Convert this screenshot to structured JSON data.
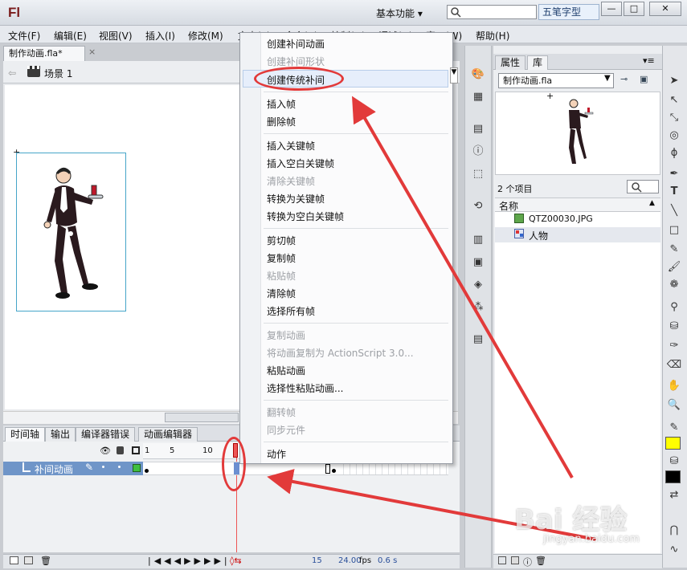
{
  "app": {
    "logo": "Fl",
    "workspace_label": "基本功能 ▾",
    "search_placeholder": "",
    "ime_label": "五笔字型",
    "window_controls": [
      "—",
      "□",
      "✕"
    ]
  },
  "menubar": {
    "items": [
      "文件(F)",
      "编辑(E)",
      "视图(V)",
      "插入(I)",
      "修改(M)",
      "文本(T)",
      "命令(C)",
      "控制(O)",
      "调试(D)",
      "窗口(W)",
      "帮助(H)"
    ]
  },
  "document": {
    "tab_label": "制作动画.fla*",
    "tab_close": "×",
    "scene_label": "场景 1"
  },
  "context_menu": {
    "items": [
      {
        "label": "创建补间动画",
        "enabled": true
      },
      {
        "label": "创建补间形状",
        "enabled": false
      },
      {
        "label": "创建传统补间",
        "enabled": true,
        "highlighted": true
      },
      {
        "label": "插入帧",
        "enabled": true
      },
      {
        "label": "删除帧",
        "enabled": true
      },
      {
        "label": "插入关键帧",
        "enabled": true
      },
      {
        "label": "插入空白关键帧",
        "enabled": true
      },
      {
        "label": "清除关键帧",
        "enabled": false
      },
      {
        "label": "转换为关键帧",
        "enabled": true
      },
      {
        "label": "转换为空白关键帧",
        "enabled": true
      },
      {
        "label": "剪切帧",
        "enabled": true
      },
      {
        "label": "复制帧",
        "enabled": true
      },
      {
        "label": "粘贴帧",
        "enabled": false
      },
      {
        "label": "清除帧",
        "enabled": true
      },
      {
        "label": "选择所有帧",
        "enabled": true
      },
      {
        "label": "复制动画",
        "enabled": false
      },
      {
        "label": "将动画复制为 ActionScript 3.0...",
        "enabled": false
      },
      {
        "label": "粘贴动画",
        "enabled": true
      },
      {
        "label": "选择性粘贴动画...",
        "enabled": true
      },
      {
        "label": "翻转帧",
        "enabled": false
      },
      {
        "label": "同步元件",
        "enabled": false
      },
      {
        "label": "动作",
        "enabled": true
      }
    ]
  },
  "timeline": {
    "tabs": [
      "时间轴",
      "输出",
      "编译器错误",
      "动画编辑器"
    ],
    "ruler_labels": [
      "1",
      "5",
      "10"
    ],
    "layer_name": "补间动画",
    "status": {
      "frame": "15",
      "fps": "24.00",
      "fps_unit": "fps",
      "time": "0.6 s"
    }
  },
  "library": {
    "tabs": [
      "属性",
      "库"
    ],
    "file_select": "制作动画.fla",
    "item_count": "2 个项目",
    "column_name": "名称",
    "items": [
      {
        "name": "QTZ00030.JPG",
        "icon": "image-icon"
      },
      {
        "name": "人物",
        "icon": "graphic-symbol-icon"
      }
    ]
  },
  "watermark": {
    "text": "Bai 经验",
    "url": "jingyan.baidu.com"
  },
  "colors": {
    "annotation_red": "#e23a3a",
    "stroke_color": "#000000",
    "fill_color": "#ffff00"
  }
}
